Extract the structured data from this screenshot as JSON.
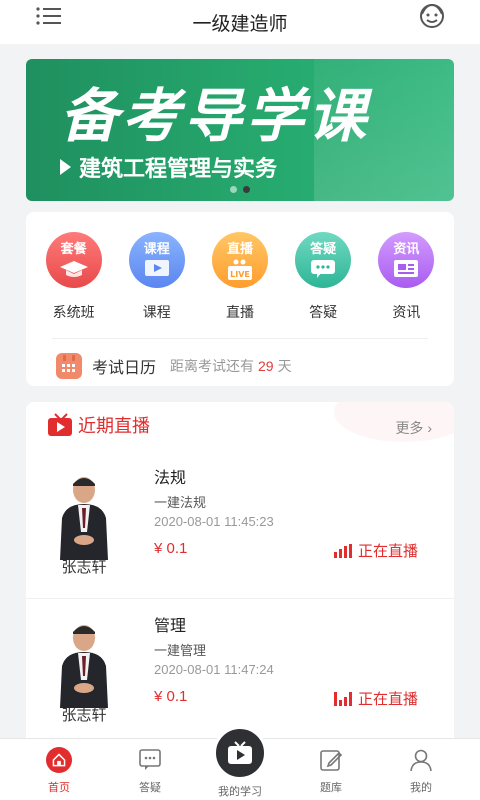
{
  "header": {
    "title": "一级建造师"
  },
  "banner": {
    "title": "备考导学课",
    "subtitle": "建筑工程管理与实务"
  },
  "shortcuts": [
    {
      "tag": "套餐",
      "label": "系统班",
      "color_top": "#ff7a7a",
      "color_bottom": "#e84a4a",
      "icon": "graduation-cap-icon"
    },
    {
      "tag": "课程",
      "label": "课程",
      "color_top": "#8ab4ff",
      "color_bottom": "#5b86ef",
      "icon": "play-screen-icon"
    },
    {
      "tag": "直播",
      "label": "直播",
      "color_top": "#ffc766",
      "color_bottom": "#ff9d2e",
      "icon": "live-tv-icon"
    },
    {
      "tag": "答疑",
      "label": "答疑",
      "color_top": "#6fd9c1",
      "color_bottom": "#2fb597",
      "icon": "chat-bubble-icon"
    },
    {
      "tag": "资讯",
      "label": "资讯",
      "color_top": "#d39bff",
      "color_bottom": "#a95cf0",
      "icon": "newspaper-icon"
    }
  ],
  "calendar": {
    "title": "考试日历",
    "desc": "距离考试还有",
    "days": "29",
    "unit": "天"
  },
  "live": {
    "title": "近期直播",
    "more": "更多",
    "items": [
      {
        "teacher": "张志轩",
        "title": "法规",
        "subtitle": "一建法规",
        "time": "2020-08-01 11:45:23",
        "price": "¥ 0.1",
        "status": "正在直播"
      },
      {
        "teacher": "张志轩",
        "title": "管理",
        "subtitle": "一建管理",
        "time": "2020-08-01 11:47:24",
        "price": "¥ 0.1",
        "status": "正在直播"
      }
    ]
  },
  "tabbar": {
    "home": "首页",
    "qa": "答疑",
    "study": "我的学习",
    "bank": "题库",
    "mine": "我的"
  },
  "colors": {
    "accent": "#e12d2d",
    "banner_green": "#26a86d"
  }
}
